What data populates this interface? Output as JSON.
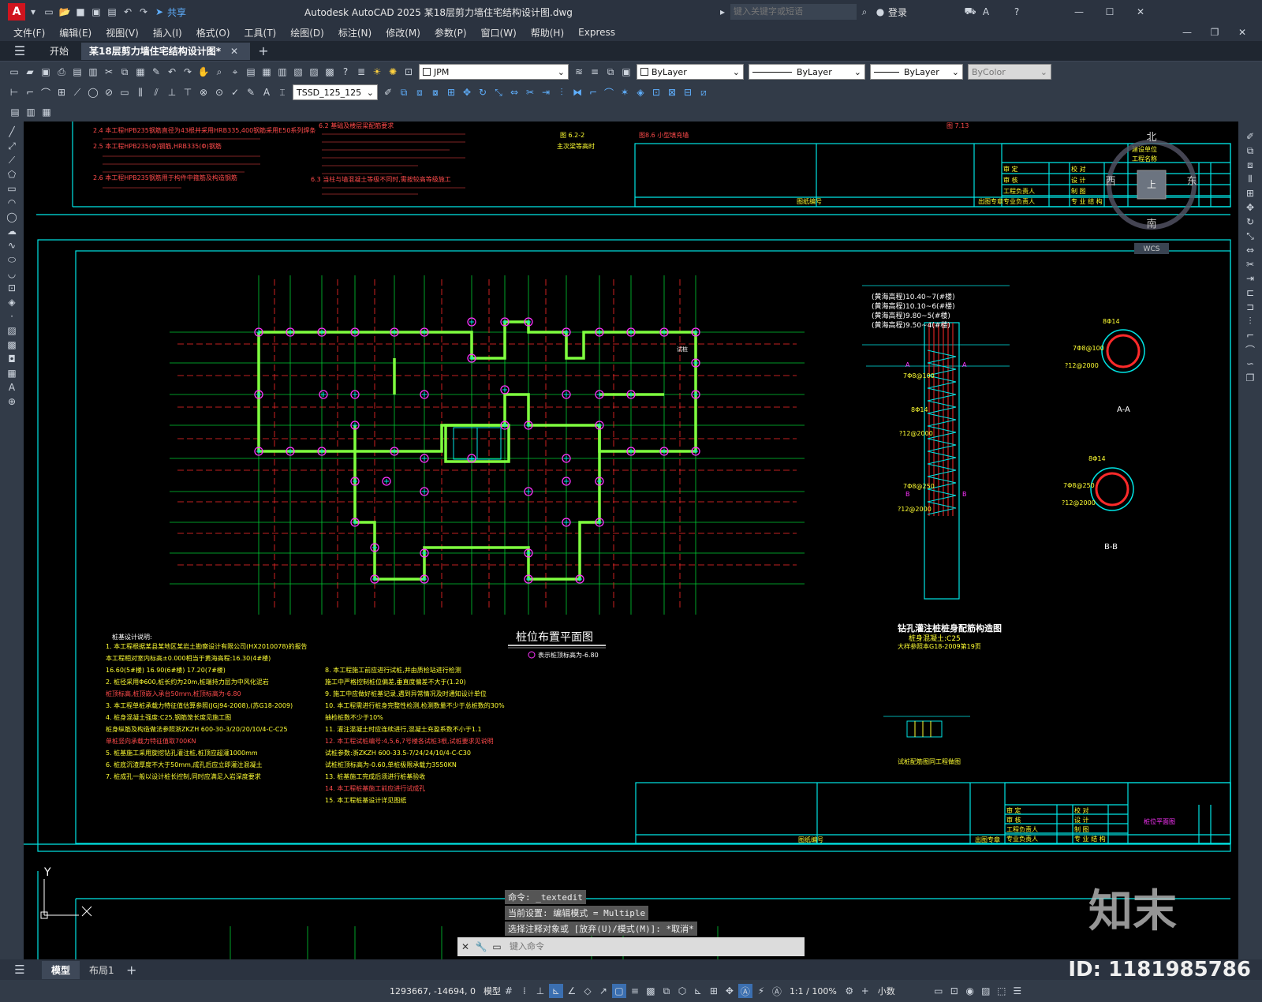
{
  "titlebar": {
    "app_logo": "A",
    "share": "共享",
    "title": "Autodesk AutoCAD 2025  某18层剪力墙住宅结构设计图.dwg",
    "search_placeholder": "键入关键字或短语",
    "login": "登录"
  },
  "menu": [
    "文件(F)",
    "编辑(E)",
    "视图(V)",
    "插入(I)",
    "格式(O)",
    "工具(T)",
    "绘图(D)",
    "标注(N)",
    "修改(M)",
    "参数(P)",
    "窗口(W)",
    "帮助(H)",
    "Express"
  ],
  "tabs": {
    "start": "开始",
    "doc": "某18层剪力墙住宅结构设计图*"
  },
  "toolbar": {
    "layer": "JPM",
    "color": "ByLayer",
    "linetype": "ByLayer",
    "lineweight": "ByLayer",
    "plotstyle": "ByColor",
    "textstyle": "TSSD_125_125"
  },
  "viewcube": {
    "north": "北",
    "south": "南",
    "east": "东",
    "west": "西",
    "top": "上",
    "wcs": "WCS"
  },
  "drawing": {
    "notes_top_left": [
      "2.4 本工程HPB235钢筋直径为43根并采用HRB335,400钢筋采用E50系列焊条",
      "2.5 本工程HPB235(Φ)钢筋,HRB335(Φ)钢筋",
      "2.6 本工程HPB235钢筋用于构件中箍筋及构造钢筋"
    ],
    "notes_top_mid": [
      "6.2 基础及楼层梁配筋要求",
      "6.3 当柱与墙混凝土等级不同时,需按较高等级施工"
    ],
    "fig_622": "图 6.2-2",
    "fig_622_caption": "主次梁等高时",
    "fig_86": "图8.6 小型填充墙",
    "fig_713": "图 7.13",
    "plan_title": "桩位布置平面图",
    "plan_legend": "表示桩顶标高为-6.80",
    "section_levels": [
      "(黄海高程)10.40~7(#楼)",
      "(黄海高程)10.10~6(#楼)",
      "(黄海高程)9.80~5(#楼)",
      "(黄海高程)9.50~4(#楼)"
    ],
    "pile_labels": {
      "a": "A",
      "b": "B",
      "b8": "7Φ8@100",
      "bt14": "8Φ14",
      "spiral": "?12@2000",
      "aa": "A-A",
      "bb": "B-B",
      "label_8a14": "8Φ14",
      "label_7b8_100": "7Φ8@100",
      "label_12_2000": "?12@2000",
      "label_8b8_250": "7Φ8@250",
      "bb_label_12": "?12@2000",
      "bb_label_8": "8Φ14"
    },
    "pile_title": "钻孔灌注桩桩身配筋构造图",
    "pile_sub1": "桩身混凝土:C25",
    "pile_sub2": "大样参照本G18-2009第19页",
    "detail_title": "试桩配筋图同工程做图",
    "pile_notes_title": "桩基设计说明:",
    "pile_notes_left": [
      "1. 本工程根据某县某地区某岩土勘察设计有限公司(HX2010078)的报告",
      "    本工程相对室内标高±0.000相当于黄海高程:16.30(4#楼)",
      "    16.60(5#楼)  16.90(6#楼)  17.20(7#楼)",
      "2. 桩径采用Φ600,桩长约为20m,桩端持力层为中风化泥岩",
      "    桩顶标高,桩顶嵌入承台50mm,桩顶标高为-6.80",
      "3. 本工程单桩承载力特征值估算参照(JGJ94-2008),(苏G18-2009)",
      "4. 桩身混凝土强度:C25,钢筋笼长度见施工图",
      "    桩身纵筋及构造做法参照浙ZKZH 600-30-3/20/20/10/4-C-C25",
      "    单桩竖向承载力特征值取700KN",
      "5. 桩基施工采用旋挖钻孔灌注桩,桩顶应超灌1000mm",
      "6. 桩底沉渣厚度不大于50mm,成孔后应立即灌注混凝土",
      "7. 桩成孔一般以设计桩长控制,同时应满足入岩深度要求"
    ],
    "pile_notes_mid": [
      "8. 本工程施工前应进行试桩,并由质检站进行检测",
      "    施工中严格控制桩位偏差,垂直度偏差不大于(1.20)",
      "9. 施工中应做好桩基记录,遇到异常情况及时通知设计单位",
      "10. 本工程需进行桩身完整性检测,检测数量不少于总桩数的30%",
      "    抽检桩数不少于10%",
      "11. 灌注混凝土时应连续进行,混凝土充盈系数不小于1.1",
      "12. 本工程试桩编号:4,5,6,7号楼各试桩3根,试桩要求见说明",
      "    试桩参数:浙ZKZH 600-33.5-7/24/24/10/4-C-C30",
      "    试桩桩顶标高为-0.60,单桩极限承载力3550KN",
      "13. 桩基施工完成后须进行桩基验收",
      "14. 本工程桩基施工前应进行试成孔",
      "15. 本工程桩基设计详见图纸"
    ],
    "title_block_rows": [
      "审  定",
      "审  核",
      "工程负责人",
      "专业负责人"
    ],
    "title_block_cols": [
      "校 对",
      "设 计",
      "制 图",
      "专 业 结 构"
    ],
    "title_block_top": [
      "建设单位",
      "工程名称"
    ],
    "tb_foot_left": "图纸编号",
    "tb_foot_right": "出图专章",
    "plan_note": "桩位平面图"
  },
  "command": {
    "lines": [
      "命令: _textedit",
      "当前设置: 编辑模式 = Multiple",
      "选择注释对象或 [放弃(U)/模式(M)]: *取消*"
    ],
    "placeholder": "键入命令"
  },
  "axes": {
    "y": "Y"
  },
  "layout_tabs": [
    "模型",
    "布局1"
  ],
  "status": {
    "coords": "1293667, -14694, 0",
    "model": "模型",
    "scale": "1:1 / 100%",
    "units": "小数"
  },
  "watermark": {
    "logo": "知末",
    "id": "ID: 1181985786"
  }
}
